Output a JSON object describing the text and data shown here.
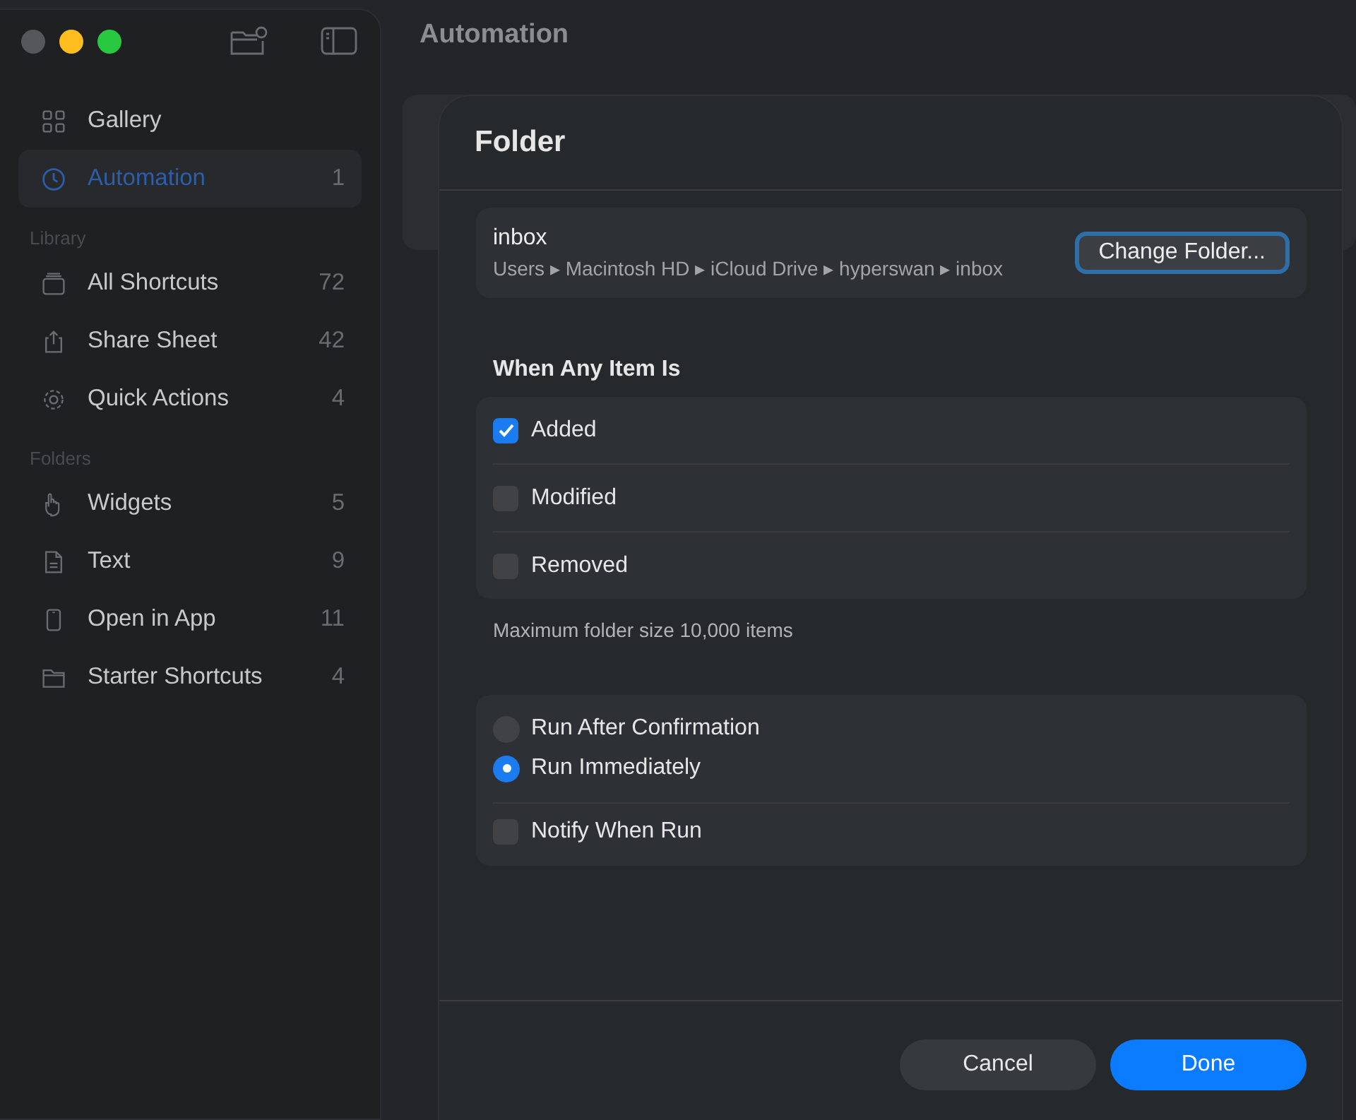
{
  "window": {
    "title": "Automation"
  },
  "sidebar": {
    "items": [
      {
        "label": "Gallery",
        "selected": false
      },
      {
        "label": "Automation",
        "count": "1",
        "selected": true
      }
    ],
    "sections": [
      {
        "title": "Library",
        "items": [
          {
            "label": "All Shortcuts",
            "count": "72",
            "selected": false
          },
          {
            "label": "Share Sheet",
            "count": "42",
            "selected": false
          },
          {
            "label": "Quick Actions",
            "count": "4",
            "selected": false
          }
        ]
      },
      {
        "title": "Folders",
        "items": [
          {
            "label": "Widgets",
            "count": "5",
            "selected": false
          },
          {
            "label": "Text",
            "count": "9",
            "selected": false
          },
          {
            "label": "Open in App",
            "count": "11",
            "selected": false
          },
          {
            "label": "Starter Shortcuts",
            "count": "4",
            "selected": false
          }
        ]
      }
    ]
  },
  "dialog": {
    "title": "Folder",
    "folder": {
      "name": "inbox",
      "path": "Users ▸ Macintosh HD ▸ iCloud Drive ▸ hyperswan ▸ inbox",
      "button": "Change Folder..."
    },
    "events_heading": "When Any Item Is",
    "events": [
      {
        "label": "Added",
        "checked": true
      },
      {
        "label": "Modified",
        "checked": false
      },
      {
        "label": "Removed",
        "checked": false
      }
    ],
    "note": "Maximum folder size 10,000 items",
    "options": [
      {
        "kind": "radio",
        "label": "Run After Confirmation",
        "selected": false
      },
      {
        "kind": "radio",
        "label": "Run Immediately",
        "selected": true
      },
      {
        "kind": "checkbox",
        "label": "Notify When Run",
        "checked": false
      }
    ],
    "buttons": [
      {
        "kind": "secondary",
        "label": "Cancel"
      },
      {
        "kind": "primary",
        "label": "Done"
      }
    ]
  }
}
